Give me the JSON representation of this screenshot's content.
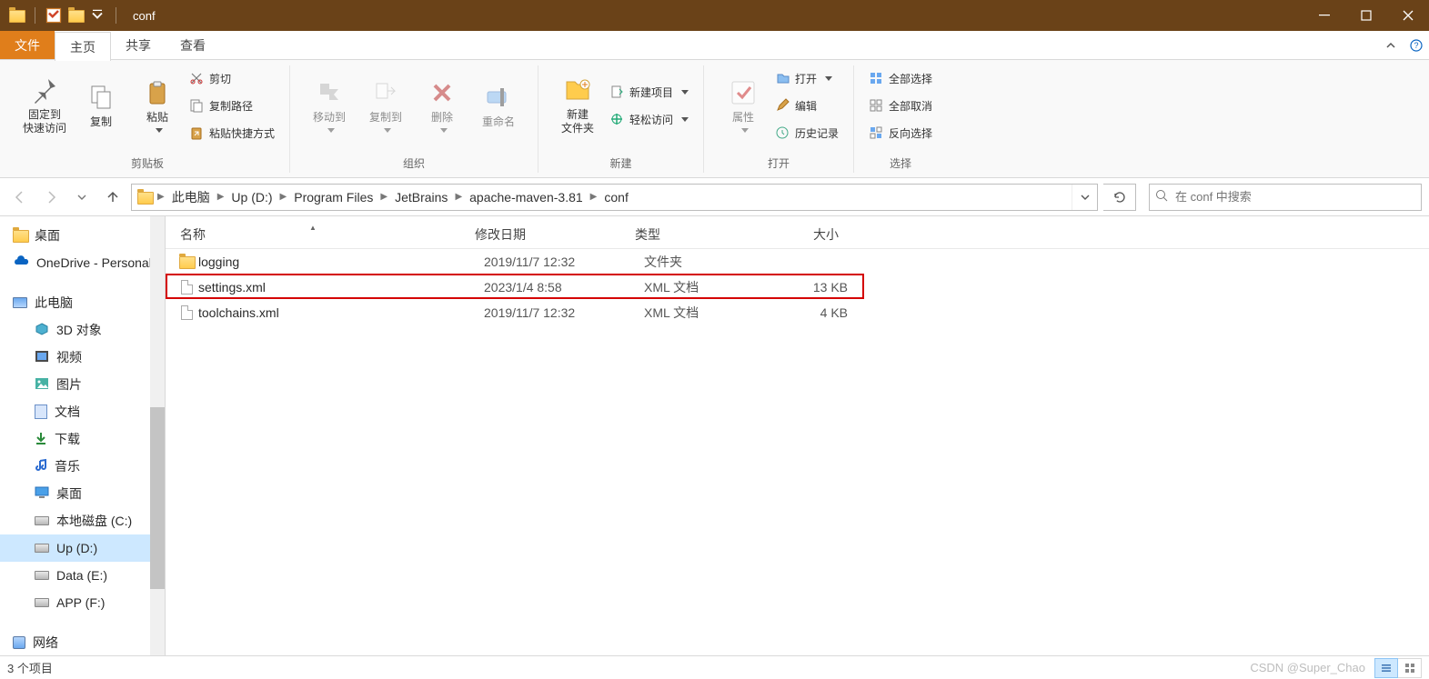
{
  "title": "conf",
  "tabs": {
    "file": "文件",
    "home": "主页",
    "share": "共享",
    "view": "查看"
  },
  "ribbon": {
    "pin_quick": "固定到\n快速访问",
    "copy": "复制",
    "paste": "粘贴",
    "cut": "剪切",
    "copy_path": "复制路径",
    "paste_shortcut": "粘贴快捷方式",
    "move_to": "移动到",
    "copy_to": "复制到",
    "delete": "删除",
    "rename": "重命名",
    "new_folder": "新建\n文件夹",
    "new_item": "新建项目",
    "easy_access": "轻松访问",
    "properties": "属性",
    "open": "打开",
    "edit": "编辑",
    "history": "历史记录",
    "select_all": "全部选择",
    "select_none": "全部取消",
    "invert_sel": "反向选择",
    "group": {
      "clipboard": "剪贴板",
      "organize": "组织",
      "new": "新建",
      "open": "打开",
      "select": "选择"
    }
  },
  "breadcrumb": [
    "此电脑",
    "Up (D:)",
    "Program Files",
    "JetBrains",
    "apache-maven-3.81",
    "conf"
  ],
  "search": {
    "placeholder": "在 conf 中搜索"
  },
  "nav_pane": [
    {
      "icon": "folder",
      "label": "桌面"
    },
    {
      "icon": "onedrive",
      "label": "OneDrive - Personal"
    },
    {
      "space": true
    },
    {
      "icon": "pc",
      "label": "此电脑"
    },
    {
      "icon": "cube",
      "label": "3D 对象",
      "child": true
    },
    {
      "icon": "video",
      "label": "视频",
      "child": true
    },
    {
      "icon": "picture",
      "label": "图片",
      "child": true
    },
    {
      "icon": "doc",
      "label": "文档",
      "child": true
    },
    {
      "icon": "download",
      "label": "下载",
      "child": true
    },
    {
      "icon": "music",
      "label": "音乐",
      "child": true
    },
    {
      "icon": "desktop",
      "label": "桌面",
      "child": true
    },
    {
      "icon": "drive",
      "label": "本地磁盘 (C:)",
      "child": true
    },
    {
      "icon": "drive",
      "label": "Up (D:)",
      "child": true,
      "selected": true
    },
    {
      "icon": "drive",
      "label": "Data (E:)",
      "child": true
    },
    {
      "icon": "drive",
      "label": "APP (F:)",
      "child": true
    },
    {
      "space": true
    },
    {
      "icon": "network",
      "label": "网络"
    }
  ],
  "columns": {
    "name": "名称",
    "date": "修改日期",
    "type": "类型",
    "size": "大小"
  },
  "rows": [
    {
      "icon": "folder",
      "name": "logging",
      "date": "2019/11/7 12:32",
      "type": "文件夹",
      "size": ""
    },
    {
      "icon": "file",
      "name": "settings.xml",
      "date": "2023/1/4 8:58",
      "type": "XML 文档",
      "size": "13 KB",
      "highlight": true
    },
    {
      "icon": "file",
      "name": "toolchains.xml",
      "date": "2019/11/7 12:32",
      "type": "XML 文档",
      "size": "4 KB"
    }
  ],
  "status": {
    "count": "3 个项目",
    "watermark": "CSDN @Super_Chao"
  }
}
